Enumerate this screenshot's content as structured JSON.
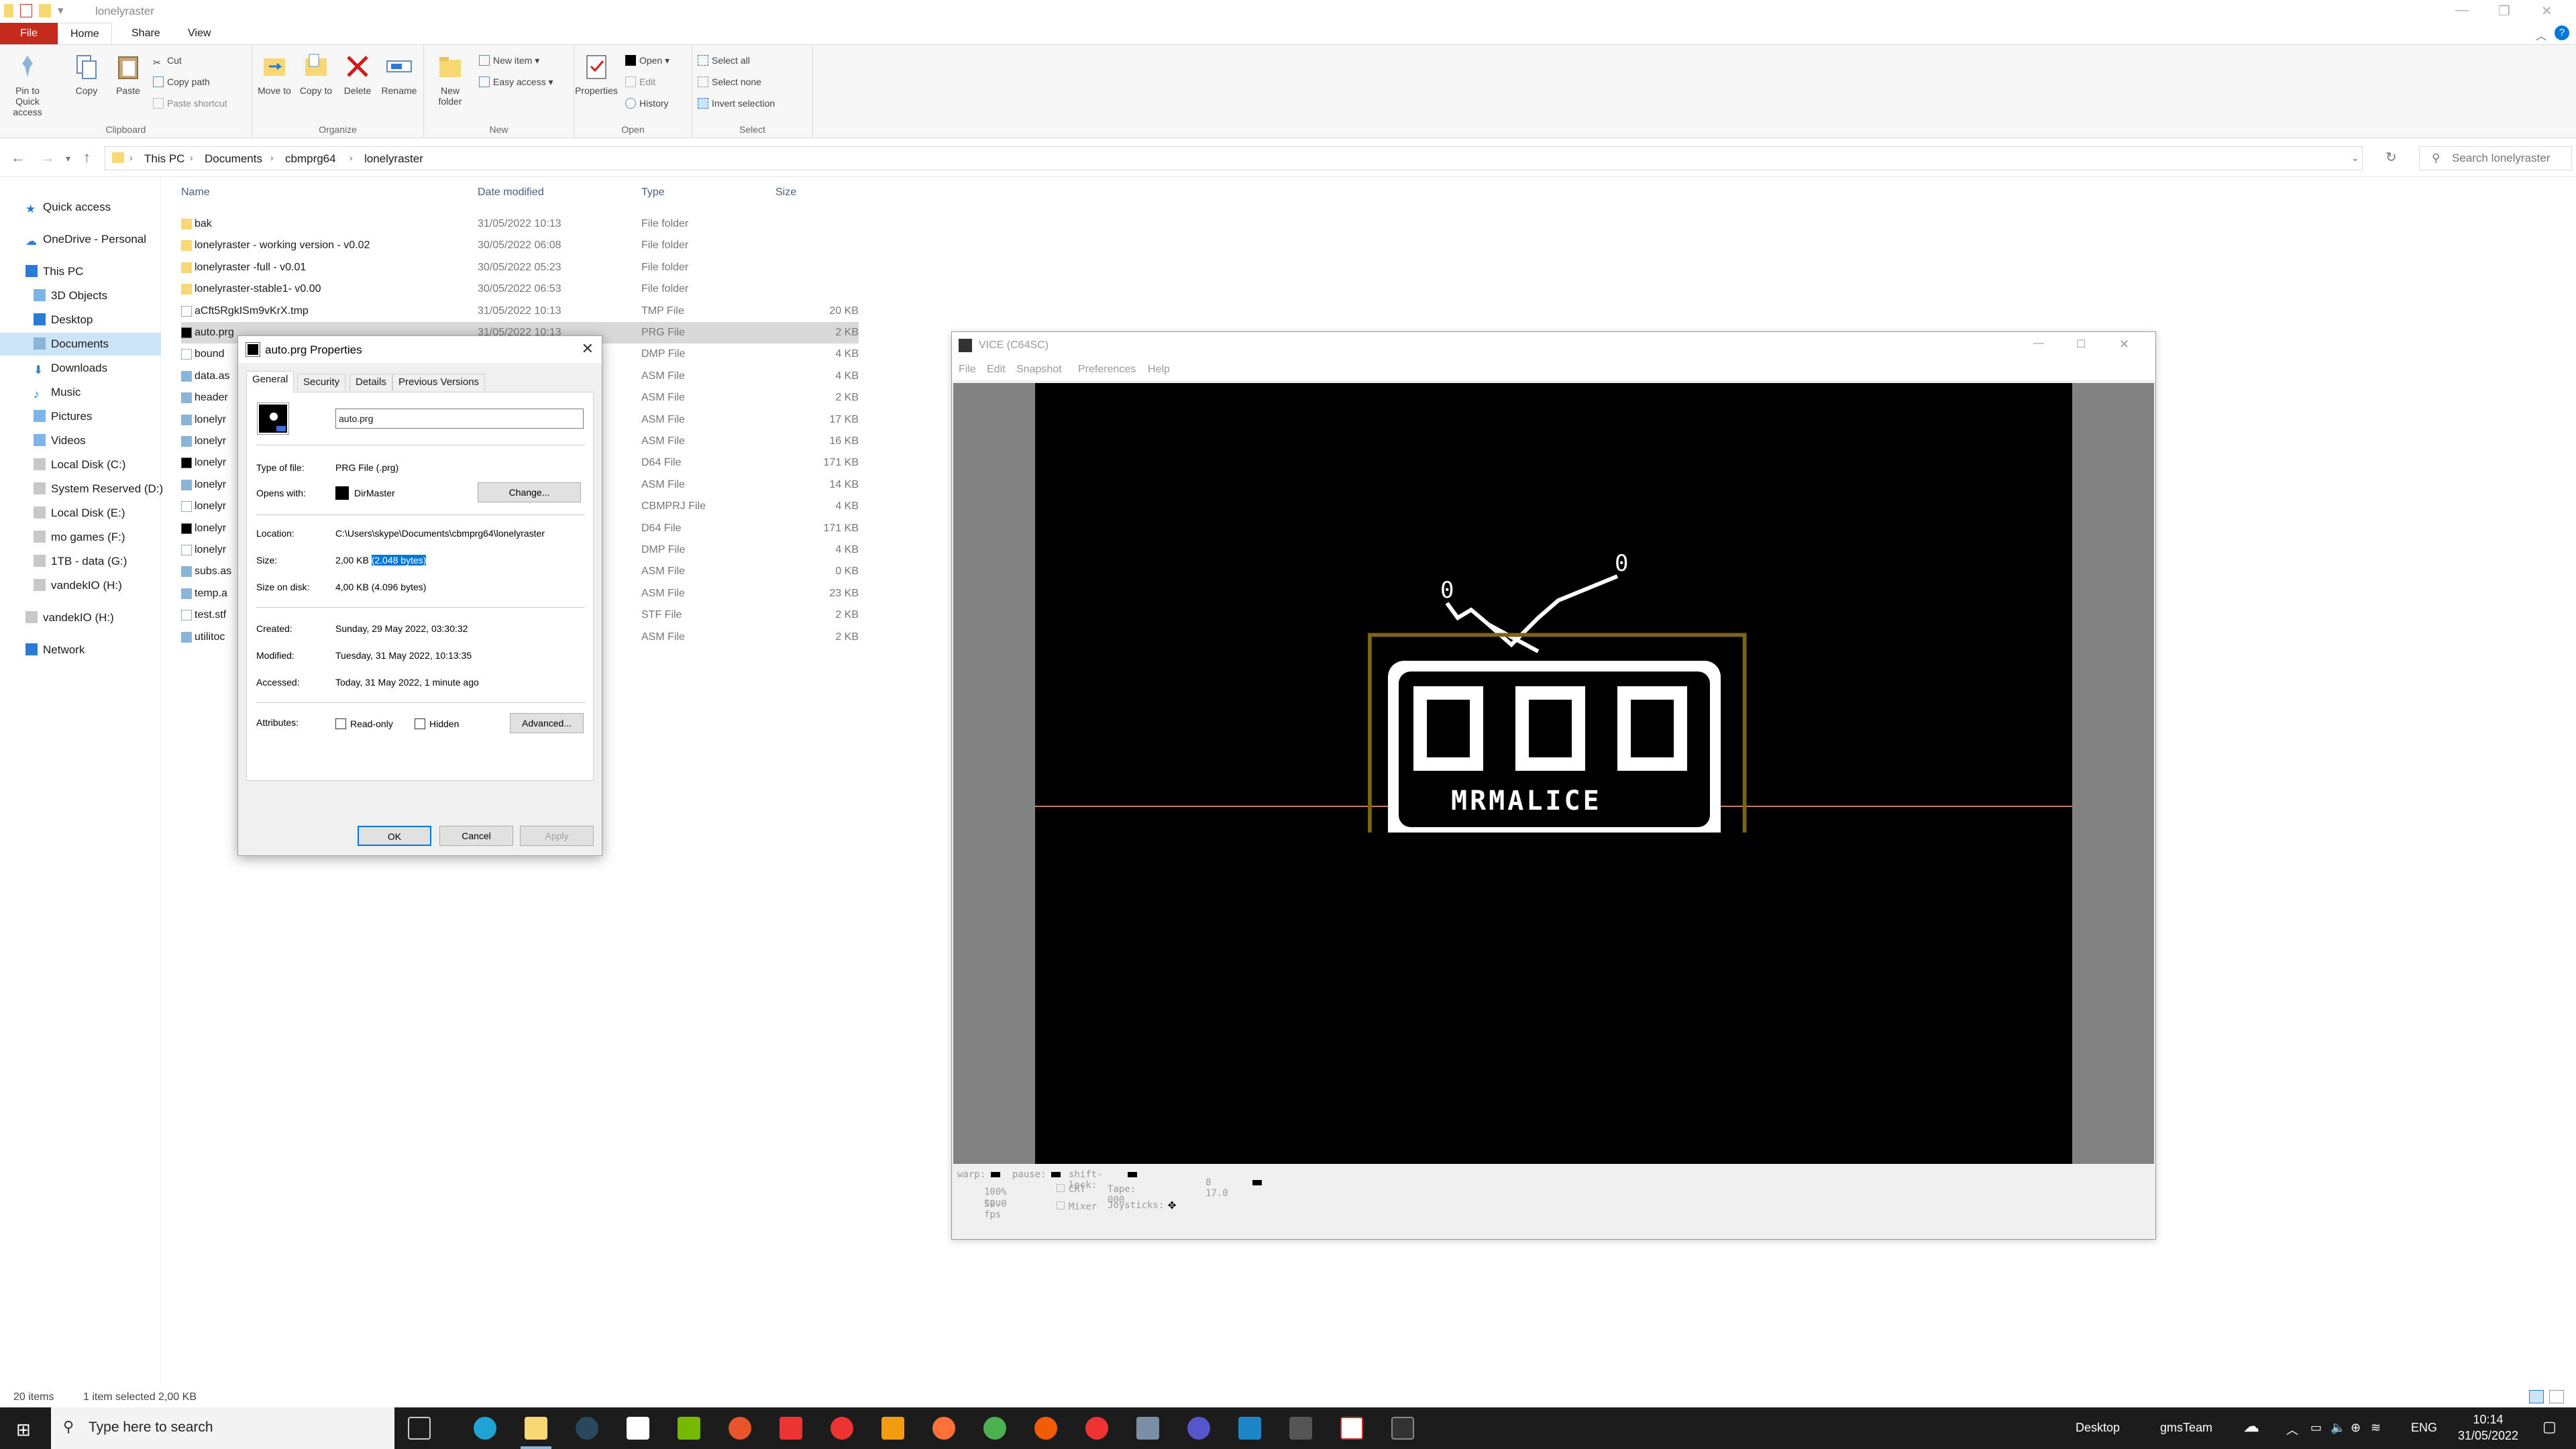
{
  "window": {
    "title": "lonelyraster"
  },
  "ribbon": {
    "tabs": [
      "File",
      "Home",
      "Share",
      "View"
    ],
    "clipboard": {
      "pin_label": "Pin to Quick access",
      "copy_label": "Copy",
      "paste_label": "Paste",
      "cut_label": "Cut",
      "copy_path_label": "Copy path",
      "paste_shortcut_label": "Paste shortcut",
      "group_label": "Clipboard"
    },
    "organize": {
      "move_to_label": "Move to",
      "copy_to_label": "Copy to",
      "delete_label": "Delete",
      "rename_label": "Rename",
      "group_label": "Organize"
    },
    "new": {
      "new_folder_label": "New folder",
      "new_item_label": "New item",
      "easy_access_label": "Easy access",
      "group_label": "New"
    },
    "open": {
      "properties_label": "Properties",
      "open_label": "Open",
      "edit_label": "Edit",
      "history_label": "History",
      "group_label": "Open"
    },
    "select": {
      "select_all_label": "Select all",
      "select_none_label": "Select none",
      "invert_label": "Invert selection",
      "group_label": "Select"
    }
  },
  "address": {
    "crumbs": [
      "This PC",
      "Documents",
      "cbmprg64",
      "lonelyraster"
    ],
    "search_placeholder": "Search lonelyraster"
  },
  "nav": {
    "items": [
      {
        "label": "Quick access"
      },
      {
        "label": "OneDrive - Personal"
      },
      {
        "label": "This PC"
      },
      {
        "label": "3D Objects"
      },
      {
        "label": "Desktop"
      },
      {
        "label": "Documents"
      },
      {
        "label": "Downloads"
      },
      {
        "label": "Music"
      },
      {
        "label": "Pictures"
      },
      {
        "label": "Videos"
      },
      {
        "label": "Local Disk (C:)"
      },
      {
        "label": "System Reserved (D:)"
      },
      {
        "label": "Local Disk (E:)"
      },
      {
        "label": "mo games (F:)"
      },
      {
        "label": "1TB - data (G:)"
      },
      {
        "label": "vandekIO (H:)"
      },
      {
        "label": "vandekIO (H:)"
      },
      {
        "label": "Network"
      }
    ]
  },
  "files": {
    "headers": {
      "name": "Name",
      "date": "Date modified",
      "type": "Type",
      "size": "Size"
    },
    "rows": [
      {
        "name": "bak",
        "date": "31/05/2022 10:13",
        "type": "File folder",
        "size": ""
      },
      {
        "name": "lonelyraster - working version - v0.02",
        "date": "30/05/2022 06:08",
        "type": "File folder",
        "size": ""
      },
      {
        "name": "lonelyraster -full - v0.01",
        "date": "30/05/2022 05:23",
        "type": "File folder",
        "size": ""
      },
      {
        "name": "lonelyraster-stable1- v0.00",
        "date": "30/05/2022 06:53",
        "type": "File folder",
        "size": ""
      },
      {
        "name": "aCft5RgkISm9vKrX.tmp",
        "date": "31/05/2022 10:13",
        "type": "TMP File",
        "size": "20 KB"
      },
      {
        "name": "auto.prg",
        "date": "31/05/2022 10:13",
        "type": "PRG File",
        "size": "2 KB"
      },
      {
        "name": "bound",
        "date": "",
        "type": "DMP File",
        "size": "4 KB"
      },
      {
        "name": "data.as",
        "date": "",
        "type": "ASM File",
        "size": "4 KB"
      },
      {
        "name": "header",
        "date": "",
        "type": "ASM File",
        "size": "2 KB"
      },
      {
        "name": "lonelyr",
        "date": "",
        "type": "ASM File",
        "size": "17 KB"
      },
      {
        "name": "lonelyr",
        "date": "",
        "type": "ASM File",
        "size": "16 KB"
      },
      {
        "name": "lonelyr",
        "date": "",
        "type": "D64 File",
        "size": "171 KB"
      },
      {
        "name": "lonelyr",
        "date": "",
        "type": "ASM File",
        "size": "14 KB"
      },
      {
        "name": "lonelyr",
        "date": "",
        "type": "CBMPRJ File",
        "size": "4 KB"
      },
      {
        "name": "lonelyr",
        "date": "",
        "type": "D64 File",
        "size": "171 KB"
      },
      {
        "name": "lonelyr",
        "date": "",
        "type": "DMP File",
        "size": "4 KB"
      },
      {
        "name": "subs.as",
        "date": "",
        "type": "ASM File",
        "size": "0 KB"
      },
      {
        "name": "temp.a",
        "date": "",
        "type": "ASM File",
        "size": "23 KB"
      },
      {
        "name": "test.stf",
        "date": "",
        "type": "STF File",
        "size": "2 KB"
      },
      {
        "name": "utilitoc",
        "date": "",
        "type": "ASM File",
        "size": "2 KB"
      }
    ]
  },
  "status": {
    "count": "20 items",
    "selection": "1 item selected  2,00 KB"
  },
  "properties": {
    "title": "auto.prg Properties",
    "tabs": [
      "General",
      "Security",
      "Details",
      "Previous Versions"
    ],
    "filename": "auto.prg",
    "type_label": "Type of file:",
    "type_value": "PRG File (.prg)",
    "opens_label": "Opens with:",
    "opens_value": "DirMaster",
    "change_label": "Change...",
    "location_label": "Location:",
    "location_value": "C:\\Users\\skype\\Documents\\cbmprg64\\lonelyraster",
    "size_label": "Size:",
    "size_value": "2,00 KB",
    "size_bytes": "(2.048 bytes)",
    "disk_label": "Size on disk:",
    "disk_value": "4,00 KB (4.096 bytes)",
    "created_label": "Created:",
    "created_value": "Sunday, 29 May 2022, 03:30:32",
    "modified_label": "Modified:",
    "modified_value": "Tuesday, 31 May 2022, 10:13:35",
    "accessed_label": "Accessed:",
    "accessed_value": "Today, 31 May 2022, 1 minute ago",
    "attributes_label": "Attributes:",
    "readonly_label": "Read-only",
    "hidden_label": "Hidden",
    "advanced_label": "Advanced...",
    "ok_label": "OK",
    "cancel_label": "Cancel",
    "apply_label": "Apply"
  },
  "vice": {
    "title": "VICE (C64SC)",
    "menu": [
      "File",
      "Edit",
      "Snapshot",
      "Preferences",
      "Help"
    ],
    "screen_text": "MRMALICE",
    "status": {
      "warp": "warp:",
      "pause": "pause:",
      "shift": "shift-lock:",
      "cpu": "100% cpu",
      "fps": "50.0 fps",
      "crt": "CRT",
      "mixer": "Mixer",
      "tape": "Tape: 000",
      "joysticks": "Joysticks:",
      "drive": "8 17.0"
    }
  },
  "taskbar": {
    "search_placeholder": "Type here to search",
    "desktop_label": "Desktop",
    "gms_label": "gmsTeam",
    "lang": "ENG",
    "time": "10:14",
    "date": "31/05/2022"
  },
  "colors": {
    "accent": "#0078d7",
    "file_tab": "#c42b1c",
    "folder": "#f8d775",
    "selection": "#cce4f7"
  }
}
